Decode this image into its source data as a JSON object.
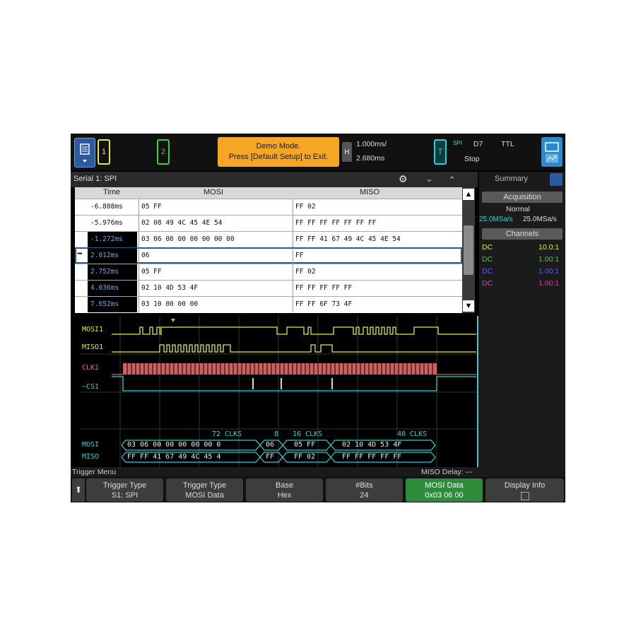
{
  "topbar": {
    "ch1": "1",
    "ch2": "2",
    "demo_line1": "Demo Mode.",
    "demo_line2": "Press [Default Setup] to Exit.",
    "h_label": "H",
    "timebase": "1.000ms/",
    "delay": "2.680ms",
    "trig_label": "T",
    "trig_src": "SPI",
    "trig_ch": "D7",
    "trig_level": "TTL",
    "trig_state": "Stop"
  },
  "serial": {
    "title": "Serial 1: SPI",
    "col_time": "Time",
    "col_mosi": "MOSI",
    "col_miso": "MISO",
    "rows": [
      {
        "time": "-6.808ms",
        "mosi": "05 FF",
        "miso": "FF 02"
      },
      {
        "time": "-5.976ms",
        "mosi": "02 08 49 4C 45 4E 54",
        "miso": "FF FF FF FF FF FF FF"
      },
      {
        "time": "-1.272ms",
        "mosi": "03 06 00 00 00 00 00 00",
        "miso": "FF FF 41 67 49 4C 45 4E 54"
      },
      {
        "time": "2.012ms",
        "mosi": "06",
        "miso": "FF"
      },
      {
        "time": "2.752ms",
        "mosi": "05 FF",
        "miso": "FF 02"
      },
      {
        "time": "4.036ms",
        "mosi": "02 10 4D 53 4F",
        "miso": "FF FF FF FF FF"
      },
      {
        "time": "7.652ms",
        "mosi": "03 10 00 00 00",
        "miso": "FF FF 6F 73 4F"
      }
    ]
  },
  "right_panel": {
    "tab": "Summary",
    "acq_label": "Acquisition",
    "acq_mode": "Normal",
    "rate1": "25.0MSa/s",
    "rate2": "25.0MSa/s",
    "channels_label": "Channels",
    "channels": [
      {
        "coupling": "DC",
        "probe": "10.0:1",
        "color": "#e8e83a"
      },
      {
        "coupling": "DC",
        "probe": "1.00:1",
        "color": "#3ad13a"
      },
      {
        "coupling": "DC",
        "probe": "1.00:1",
        "color": "#5a5aff"
      },
      {
        "coupling": "DC",
        "probe": "1.00:1",
        "color": "#e83aa0"
      }
    ]
  },
  "waveform": {
    "mosi_label": "MOSI1",
    "miso_label": "MISO1",
    "clk_label": "CLK1",
    "cs_label": "~CS1",
    "clk_annot1": "72 CLKS",
    "clk_annot2": "8",
    "clk_annot3": "16 CLKS",
    "clk_annot4": "40 CLKS",
    "bus_mosi_label": "MOSI",
    "bus_miso_label": "MISO",
    "bus_mosi_frames": [
      "03 06 00 00 00 00 00 0",
      "06",
      "05 FF",
      "02 10 4D 53 4F"
    ],
    "bus_miso_frames": [
      "FF FF 41 67 49 4C 45 4",
      "FF",
      "FF 02",
      "FF FF FF FF FF"
    ]
  },
  "trigger": {
    "menu_title": "Trigger Menu",
    "miso_delay": "MISO Delay: ---"
  },
  "softkeys": [
    {
      "label": "Trigger Type",
      "value": "S1: SPI"
    },
    {
      "label": "Trigger Type",
      "value": "MOSI Data"
    },
    {
      "label": "Base",
      "value": "Hex"
    },
    {
      "label": "#Bits",
      "value": "24"
    },
    {
      "label": "MOSI Data",
      "value": "0x03 06 00"
    },
    {
      "label": "Display Info",
      "value": ""
    }
  ],
  "colors": {
    "mosi": "#e8e83a",
    "cs": "#2bd3d3",
    "clk": "#e36f6f",
    "bus": "#2bd3d3",
    "demo": "#f5a623",
    "softkey_active": "#2e8b3a"
  }
}
